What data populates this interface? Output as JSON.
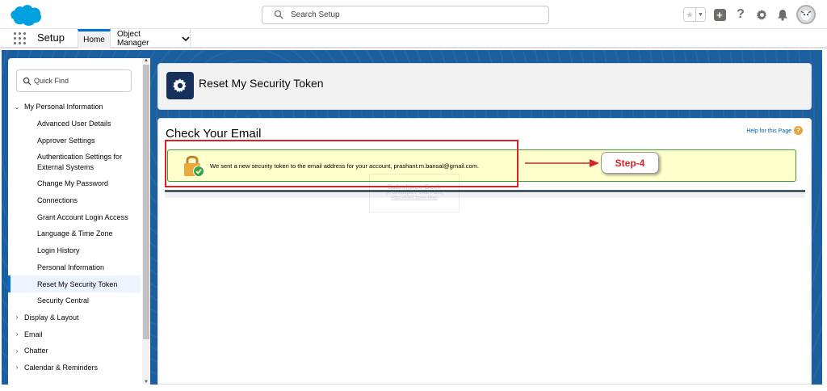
{
  "header": {
    "search_placeholder": "Search Setup"
  },
  "context_bar": {
    "app_name": "Setup",
    "tabs": [
      {
        "label": "Home"
      },
      {
        "label": "Object Manager"
      }
    ]
  },
  "sidebar": {
    "quick_find_placeholder": "Quick Find",
    "items": [
      {
        "label": "My Personal Information"
      },
      {
        "label": "Advanced User Details"
      },
      {
        "label": "Approver Settings"
      },
      {
        "label": "Authentication Settings for External Systems"
      },
      {
        "label": "Change My Password"
      },
      {
        "label": "Connections"
      },
      {
        "label": "Grant Account Login Access"
      },
      {
        "label": "Language & Time Zone"
      },
      {
        "label": "Login History"
      },
      {
        "label": "Personal Information"
      },
      {
        "label": "Reset My Security Token"
      },
      {
        "label": "Security Central"
      },
      {
        "label": "Display & Layout"
      },
      {
        "label": "Email"
      },
      {
        "label": "Chatter"
      },
      {
        "label": "Calendar & Reminders"
      }
    ]
  },
  "page_header": {
    "title": "Reset My Security Token"
  },
  "content": {
    "title": "Check Your Email",
    "help_link": "Help for this Page",
    "message": "We sent a new security token to the email address for your account, prashant.m.bansal@gmail.com."
  },
  "annotation": {
    "step_label": "Step-4"
  },
  "watermark": {
    "line1": "Salesforce Geek",
    "line2": "(A Developers' View Point)",
    "line3": "https://6302.home.blog/"
  },
  "colors": {
    "brand_blue": "#0070d2",
    "backdrop_blue": "#1b5f9e",
    "annotation_red": "#d8232a",
    "message_bg": "#ffffcc",
    "message_border": "#39a039"
  }
}
